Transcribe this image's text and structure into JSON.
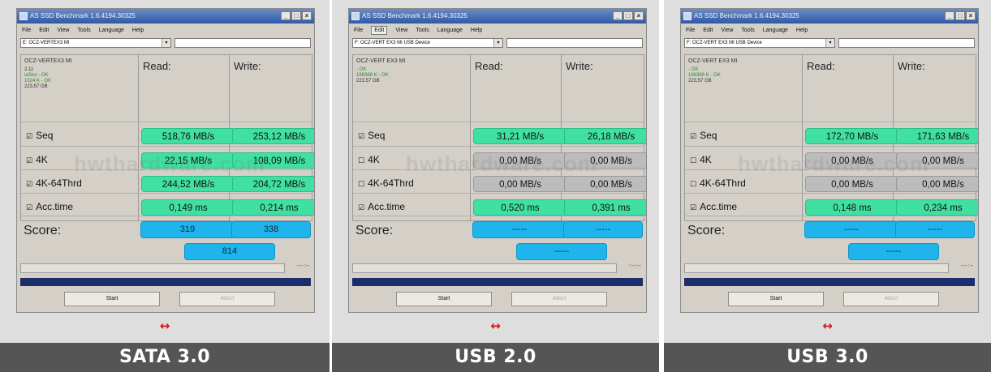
{
  "panels": [
    {
      "caption": "SATA 3.0",
      "window_title": "AS SSD Benchmark 1.6.4194.30325",
      "menu": [
        "File",
        "Edit",
        "View",
        "Tools",
        "Language",
        "Help"
      ],
      "menu_active": "",
      "drive": "E: OCZ-VERTEX3 MI",
      "device_name": "OCZ-VERTEX3 MI",
      "firmware": "2.11",
      "driver_status": "iaStor - OK",
      "align_status": "1024 K - OK",
      "capacity": "223,57 GB",
      "read_header": "Read:",
      "write_header": "Write:",
      "rows": [
        {
          "label": "Seq",
          "checked": true,
          "read": "518,76 MB/s",
          "write": "253,12 MB/s",
          "style": "green"
        },
        {
          "label": "4K",
          "checked": true,
          "read": "22,15 MB/s",
          "write": "108,09 MB/s",
          "style": "green"
        },
        {
          "label": "4K-64Thrd",
          "checked": true,
          "read": "244,52 MB/s",
          "write": "204,72 MB/s",
          "style": "green"
        },
        {
          "label": "Acc.time",
          "checked": true,
          "read": "0,149 ms",
          "write": "0,214 ms",
          "style": "green"
        }
      ],
      "score_label": "Score:",
      "score_read": "319",
      "score_write": "338",
      "score_total": "814",
      "time": "-:--:--",
      "start_label": "Start",
      "abort_label": "Abort"
    },
    {
      "caption": "USB 2.0",
      "window_title": "AS SSD Benchmark 1.6.4194.30325",
      "menu": [
        "File",
        "Edit",
        "View",
        "Tools",
        "Language",
        "Help"
      ],
      "menu_active": "Edit",
      "drive": "F: OCZ-VERT EX3 MI USB Device",
      "device_name": "OCZ-VERT EX3 MI",
      "firmware": "",
      "driver_status": "- OK",
      "align_status": "186368 K - OK",
      "capacity": "223,57 GB",
      "read_header": "Read:",
      "write_header": "Write:",
      "rows": [
        {
          "label": "Seq",
          "checked": true,
          "read": "31,21 MB/s",
          "write": "26,18 MB/s",
          "style": "green"
        },
        {
          "label": "4K",
          "checked": false,
          "read": "0,00 MB/s",
          "write": "0,00 MB/s",
          "style": "gray"
        },
        {
          "label": "4K-64Thrd",
          "checked": false,
          "read": "0,00 MB/s",
          "write": "0,00 MB/s",
          "style": "gray"
        },
        {
          "label": "Acc.time",
          "checked": true,
          "read": "0,520 ms",
          "write": "0,391 ms",
          "style": "green"
        }
      ],
      "score_label": "Score:",
      "score_read": "-----",
      "score_write": "-----",
      "score_total": "-----",
      "time": "-:--:--",
      "start_label": "Start",
      "abort_label": "Abort"
    },
    {
      "caption": "USB 3.0",
      "window_title": "AS SSD Benchmark 1.6.4194.30325",
      "menu": [
        "File",
        "Edit",
        "View",
        "Tools",
        "Language",
        "Help"
      ],
      "menu_active": "",
      "drive": "F: OCZ-VERT EX3 MI USB Device",
      "device_name": "OCZ-VERT EX3 MI",
      "firmware": "",
      "driver_status": "- OK",
      "align_status": "186368 K - OK",
      "capacity": "223,57 GB",
      "read_header": "Read:",
      "write_header": "Write:",
      "rows": [
        {
          "label": "Seq",
          "checked": true,
          "read": "172,70 MB/s",
          "write": "171,63 MB/s",
          "style": "green"
        },
        {
          "label": "4K",
          "checked": false,
          "read": "0,00 MB/s",
          "write": "0,00 MB/s",
          "style": "gray"
        },
        {
          "label": "4K-64Thrd",
          "checked": false,
          "read": "0,00 MB/s",
          "write": "0,00 MB/s",
          "style": "gray"
        },
        {
          "label": "Acc.time",
          "checked": true,
          "read": "0,148 ms",
          "write": "0,234 ms",
          "style": "green"
        }
      ],
      "score_label": "Score:",
      "score_read": "-----",
      "score_write": "-----",
      "score_total": "-----",
      "time": "-:--:--",
      "start_label": "Start",
      "abort_label": "Abort"
    }
  ],
  "expand_icon": "↔",
  "watermark": "hwthardware.com",
  "colors": {
    "value_green": "#3fe0a2",
    "value_gray": "#bcbcbc",
    "score_blue": "#1fb4ec",
    "progress_blue": "#1d2c6a",
    "caption_bg": "#555555",
    "arrow_red": "#d01818"
  }
}
